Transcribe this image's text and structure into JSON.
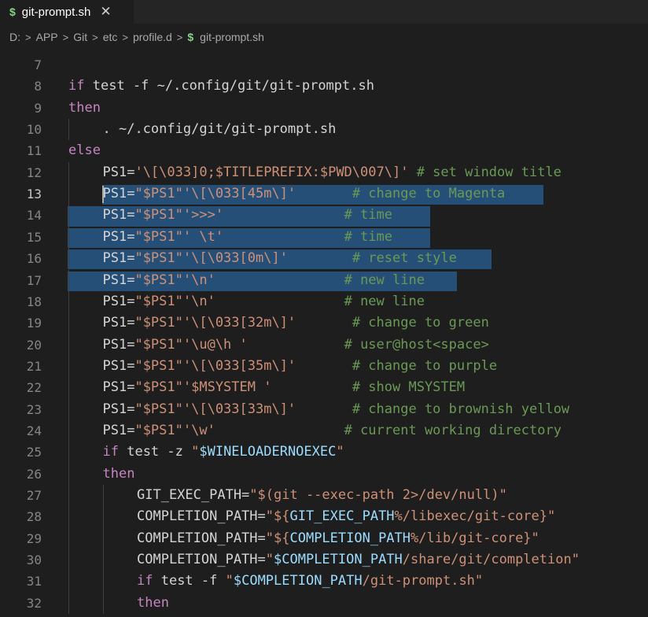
{
  "tab": {
    "icon": "$",
    "title": "git-prompt.sh",
    "close": "✕"
  },
  "breadcrumb": [
    "D:",
    "APP",
    "Git",
    "etc",
    "profile.d"
  ],
  "breadcrumb_file_icon": "$",
  "breadcrumb_file": "git-prompt.sh",
  "lines": [
    {
      "n": "7",
      "i": 0,
      "t": []
    },
    {
      "n": "8",
      "i": 0,
      "t": [
        [
          "kw",
          "if"
        ],
        [
          "plain",
          " "
        ],
        [
          "plain",
          "test"
        ],
        [
          "plain",
          " -f ~/.config/git/git-prompt.sh"
        ]
      ]
    },
    {
      "n": "9",
      "i": 0,
      "t": [
        [
          "kw",
          "then"
        ]
      ]
    },
    {
      "n": "10",
      "i": 1,
      "t": [
        [
          "plain",
          ". ~/.config/git/git-prompt.sh"
        ]
      ]
    },
    {
      "n": "11",
      "i": 0,
      "t": [
        [
          "kw",
          "else"
        ]
      ]
    },
    {
      "n": "12",
      "i": 1,
      "t": [
        [
          "plain",
          "PS1="
        ],
        [
          "str",
          "'\\[\\033]0;$TITLEPREFIX:$PWD\\007\\]'"
        ],
        [
          "com",
          " # set window title"
        ]
      ]
    },
    {
      "n": "13",
      "i": 1,
      "t": [
        [
          "plain",
          "PS1="
        ],
        [
          "str",
          "\"$PS1\""
        ],
        [
          "str",
          "'\\[\\033[45m\\]'"
        ],
        [
          "plain",
          "       "
        ],
        [
          "com",
          "# change to Magenta"
        ]
      ]
    },
    {
      "n": "14",
      "i": 1,
      "t": [
        [
          "plain",
          "PS1="
        ],
        [
          "str",
          "\"$PS1\""
        ],
        [
          "str",
          "'>>>'"
        ],
        [
          "plain",
          "               "
        ],
        [
          "com",
          "# time"
        ]
      ]
    },
    {
      "n": "15",
      "i": 1,
      "t": [
        [
          "plain",
          "PS1="
        ],
        [
          "str",
          "\"$PS1\""
        ],
        [
          "str",
          "' \\t'"
        ],
        [
          "plain",
          "               "
        ],
        [
          "com",
          "# time"
        ]
      ]
    },
    {
      "n": "16",
      "i": 1,
      "t": [
        [
          "plain",
          "PS1="
        ],
        [
          "str",
          "\"$PS1\""
        ],
        [
          "str",
          "'\\[\\033[0m\\]'"
        ],
        [
          "plain",
          "        "
        ],
        [
          "com",
          "# reset style"
        ]
      ]
    },
    {
      "n": "17",
      "i": 1,
      "t": [
        [
          "plain",
          "PS1="
        ],
        [
          "str",
          "\"$PS1\""
        ],
        [
          "str",
          "'\\n'"
        ],
        [
          "plain",
          "                "
        ],
        [
          "com",
          "# new line"
        ]
      ]
    },
    {
      "n": "18",
      "i": 1,
      "t": [
        [
          "plain",
          "PS1="
        ],
        [
          "str",
          "\"$PS1\""
        ],
        [
          "str",
          "'\\n'"
        ],
        [
          "plain",
          "                "
        ],
        [
          "com",
          "# new line"
        ]
      ]
    },
    {
      "n": "19",
      "i": 1,
      "t": [
        [
          "plain",
          "PS1="
        ],
        [
          "str",
          "\"$PS1\""
        ],
        [
          "str",
          "'\\[\\033[32m\\]'"
        ],
        [
          "plain",
          "       "
        ],
        [
          "com",
          "# change to green"
        ]
      ]
    },
    {
      "n": "20",
      "i": 1,
      "t": [
        [
          "plain",
          "PS1="
        ],
        [
          "str",
          "\"$PS1\""
        ],
        [
          "str",
          "'\\u@\\h '"
        ],
        [
          "plain",
          "            "
        ],
        [
          "com",
          "# user@host<space>"
        ]
      ]
    },
    {
      "n": "21",
      "i": 1,
      "t": [
        [
          "plain",
          "PS1="
        ],
        [
          "str",
          "\"$PS1\""
        ],
        [
          "str",
          "'\\[\\033[35m\\]'"
        ],
        [
          "plain",
          "       "
        ],
        [
          "com",
          "# change to purple"
        ]
      ]
    },
    {
      "n": "22",
      "i": 1,
      "t": [
        [
          "plain",
          "PS1="
        ],
        [
          "str",
          "\"$PS1\""
        ],
        [
          "str",
          "'$MSYSTEM '"
        ],
        [
          "plain",
          "          "
        ],
        [
          "com",
          "# show MSYSTEM"
        ]
      ]
    },
    {
      "n": "23",
      "i": 1,
      "t": [
        [
          "plain",
          "PS1="
        ],
        [
          "str",
          "\"$PS1\""
        ],
        [
          "str",
          "'\\[\\033[33m\\]'"
        ],
        [
          "plain",
          "       "
        ],
        [
          "com",
          "# change to brownish yellow"
        ]
      ]
    },
    {
      "n": "24",
      "i": 1,
      "t": [
        [
          "plain",
          "PS1="
        ],
        [
          "str",
          "\"$PS1\""
        ],
        [
          "str",
          "'\\w'"
        ],
        [
          "plain",
          "                "
        ],
        [
          "com",
          "# current working directory"
        ]
      ]
    },
    {
      "n": "25",
      "i": 1,
      "t": [
        [
          "kw",
          "if"
        ],
        [
          "plain",
          " test -z "
        ],
        [
          "str",
          "\""
        ],
        [
          "var",
          "$WINELOADERNOEXEC"
        ],
        [
          "str",
          "\""
        ]
      ]
    },
    {
      "n": "26",
      "i": 1,
      "t": [
        [
          "kw",
          "then"
        ]
      ]
    },
    {
      "n": "27",
      "i": 2,
      "t": [
        [
          "plain",
          "GIT_EXEC_PATH="
        ],
        [
          "str",
          "\"$(git --exec-path 2>/dev/null)\""
        ]
      ]
    },
    {
      "n": "28",
      "i": 2,
      "t": [
        [
          "plain",
          "COMPLETION_PATH="
        ],
        [
          "str",
          "\"${"
        ],
        [
          "var",
          "GIT_EXEC_PATH"
        ],
        [
          "str",
          "%/libexec/git-core}\""
        ]
      ]
    },
    {
      "n": "29",
      "i": 2,
      "t": [
        [
          "plain",
          "COMPLETION_PATH="
        ],
        [
          "str",
          "\"${"
        ],
        [
          "var",
          "COMPLETION_PATH"
        ],
        [
          "str",
          "%/lib/git-core}\""
        ]
      ]
    },
    {
      "n": "30",
      "i": 2,
      "t": [
        [
          "plain",
          "COMPLETION_PATH="
        ],
        [
          "str",
          "\""
        ],
        [
          "var",
          "$COMPLETION_PATH"
        ],
        [
          "str",
          "/share/git/completion\""
        ]
      ]
    },
    {
      "n": "31",
      "i": 2,
      "t": [
        [
          "kw",
          "if"
        ],
        [
          "plain",
          " test -f "
        ],
        [
          "str",
          "\""
        ],
        [
          "var",
          "$COMPLETION_PATH"
        ],
        [
          "str",
          "/git-prompt.sh\""
        ]
      ]
    },
    {
      "n": "32",
      "i": 2,
      "t": [
        [
          "kw",
          "then"
        ]
      ]
    }
  ],
  "active_line": "13",
  "selected_lines": [
    "13",
    "14",
    "15",
    "16",
    "17"
  ]
}
